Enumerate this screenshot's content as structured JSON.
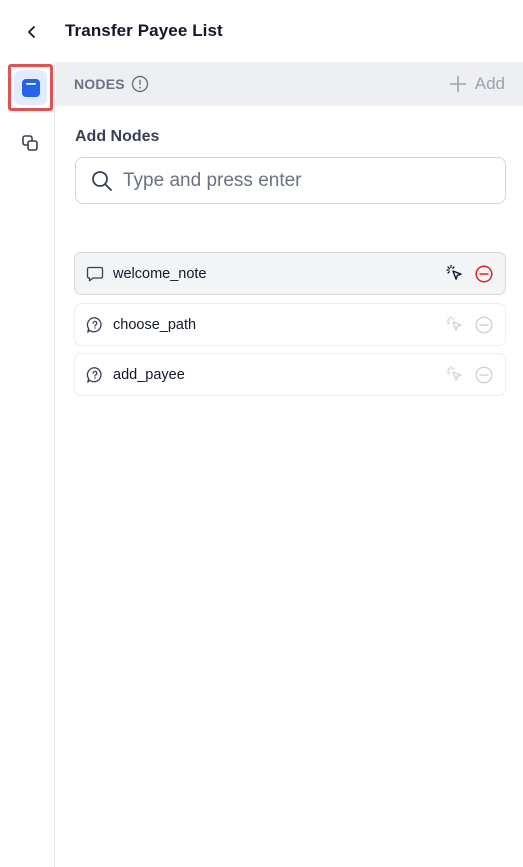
{
  "header": {
    "title": "Transfer Payee List"
  },
  "nodes_section": {
    "label": "NODES",
    "add_label": "Add"
  },
  "add_nodes": {
    "title": "Add Nodes",
    "search_placeholder": "Type and press enter",
    "search_value": ""
  },
  "node_list": [
    {
      "name": "welcome_note",
      "icon": "message-icon",
      "selected": true
    },
    {
      "name": "choose_path",
      "icon": "question-message-icon",
      "selected": false
    },
    {
      "name": "add_payee",
      "icon": "question-message-icon",
      "selected": false
    }
  ],
  "colors": {
    "accent": "#2563eb",
    "danger": "#dc2626",
    "highlight_border": "#e35252"
  }
}
